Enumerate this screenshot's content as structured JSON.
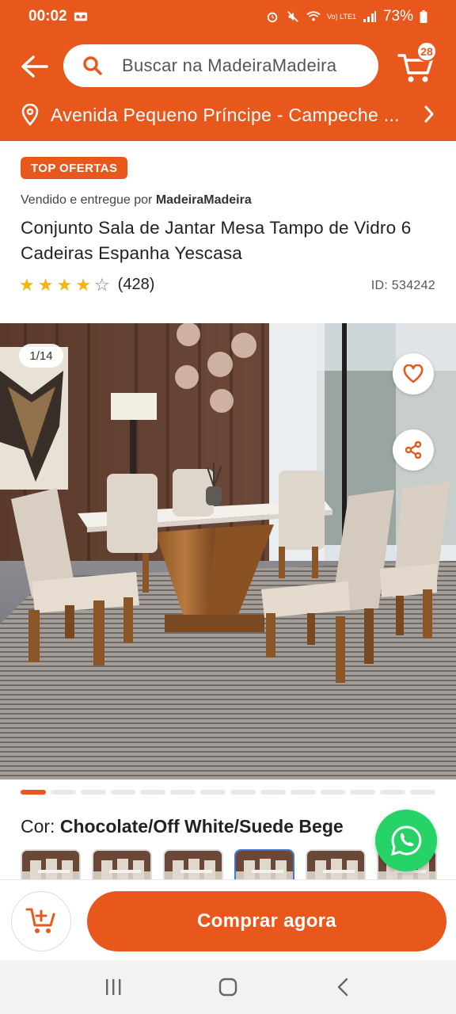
{
  "status_bar": {
    "time": "00:02",
    "battery": "73%",
    "network": "Vo) LTE1"
  },
  "header": {
    "search_placeholder": "Buscar na MadeiraMadeira",
    "cart_count": "28",
    "location": "Avenida Pequeno Príncipe - Campeche ..."
  },
  "product": {
    "tag": "TOP OFERTAS",
    "seller_prefix": "Vendido e entregue por",
    "seller_name": "MadeiraMadeira",
    "title": "Conjunto Sala de Jantar Mesa Tampo de Vidro 6 Cadeiras Espanha Yescasa",
    "rating_value": 4,
    "rating_max": 5,
    "reviews": "(428)",
    "id": "ID: 534242"
  },
  "gallery": {
    "counter": "1/14",
    "total_images": 14,
    "active_index": 0
  },
  "color": {
    "label": "Cor:",
    "value": "Chocolate/Off White/Suede Bege",
    "selected_thumb": 3
  },
  "actions": {
    "buy_label": "Comprar agora"
  },
  "colors": {
    "brand": "#e8581c",
    "whatsapp": "#25d366",
    "star": "#f5b50a",
    "thumb_selected": "#3a7bd5"
  }
}
